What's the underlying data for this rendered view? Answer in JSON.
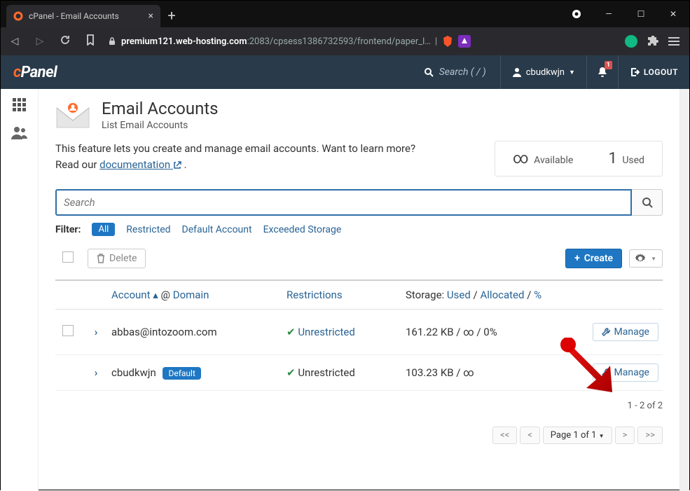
{
  "browser": {
    "tab_title": "cPanel - Email Accounts",
    "url_host": "premium121.web-hosting.com",
    "url_path": ":2083/cpsess1386732593/frontend/paper_l…"
  },
  "header": {
    "logo_c": "c",
    "logo_panel": "Panel",
    "search_placeholder": "Search ( / )",
    "username": "cbudkwjn",
    "notif_count": "1",
    "logout": "LOGOUT"
  },
  "page": {
    "title": "Email Accounts",
    "subtitle": "List Email Accounts",
    "intro_1": "This feature lets you create and manage email accounts. Want to learn more?",
    "intro_2a": "Read our ",
    "intro_link": "documentation",
    "intro_2b": " ."
  },
  "stats": {
    "avail_sym": "∞",
    "avail_lbl": "Available",
    "used_num": "1",
    "used_lbl": "Used"
  },
  "search": {
    "placeholder": "Search"
  },
  "filter": {
    "label": "Filter:",
    "all": "All",
    "restricted": "Restricted",
    "default": "Default Account",
    "exceeded": "Exceeded Storage"
  },
  "actions": {
    "delete": "Delete",
    "create": "Create"
  },
  "thead": {
    "account": "Account",
    "at": "@",
    "domain": "Domain",
    "restrictions": "Restrictions",
    "storage_lbl": "Storage:",
    "used": "Used",
    "allocated": "Allocated",
    "pct": "%"
  },
  "rows": [
    {
      "email": "abbas@intozoom.com",
      "restriction": "Unrestricted",
      "storage": "161.22 KB / ∞ / 0%",
      "manage": "Manage",
      "default": false,
      "rest_link": true,
      "has_check": true
    },
    {
      "email": "cbudkwjn",
      "restriction": "Unrestricted",
      "storage": "103.23 KB / ∞",
      "manage": "Manage",
      "default": true,
      "default_lbl": "Default",
      "rest_link": false,
      "has_check": false
    }
  ],
  "footer": {
    "range": "1 - 2 of 2",
    "page_lbl": "Page 1 of 1"
  }
}
